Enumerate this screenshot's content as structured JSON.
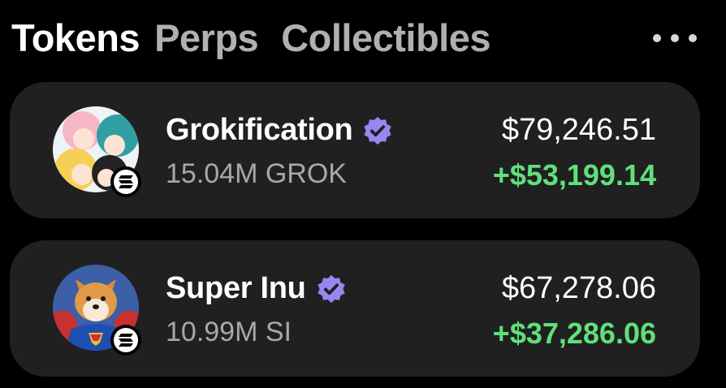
{
  "tabs": [
    {
      "label": "Tokens",
      "active": true
    },
    {
      "label": "Perps",
      "active": false
    },
    {
      "label": "Collectibles",
      "active": false
    }
  ],
  "menu_icon": "more-horizontal-icon",
  "colors": {
    "background": "#000000",
    "card": "#202020",
    "gain": "#5fe07a",
    "verified": "#9a86f0",
    "secondary_text": "#a8a8a8"
  },
  "tokens": [
    {
      "name": "Grokification",
      "verified": true,
      "amount": "15.04M GROK",
      "value": "$79,246.51",
      "change": "+$53,199.14",
      "chain_icon": "solana-icon",
      "avatar_icon": "anime-characters-avatar"
    },
    {
      "name": "Super Inu",
      "verified": true,
      "amount": "10.99M SI",
      "value": "$67,278.06",
      "change": "+$37,286.06",
      "chain_icon": "solana-icon",
      "avatar_icon": "shiba-superhero-avatar"
    }
  ]
}
